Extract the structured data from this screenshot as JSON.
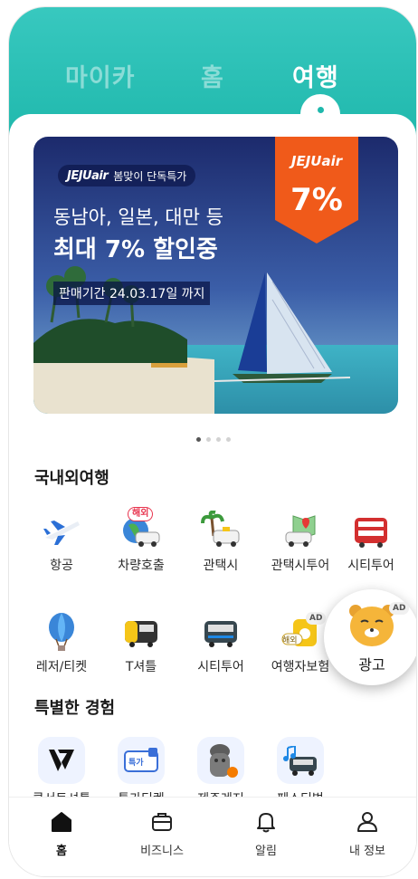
{
  "top_tabs": [
    {
      "label": "마이카",
      "active": false
    },
    {
      "label": "홈",
      "active": false
    },
    {
      "label": "여행",
      "active": true
    }
  ],
  "banner": {
    "brand": "JEJUair",
    "tag_text": "봄맞이 단독특가",
    "subtitle": "동남아, 일본, 대만 등",
    "headline": "최대 7% 할인중",
    "period": "판매기간 24.03.17일 까지",
    "badge_brand": "JEJUair",
    "badge_value": "7%",
    "page_count": 4,
    "current_page": 1
  },
  "domestic_section": {
    "title": "국내외여행",
    "items": [
      {
        "label": "항공",
        "icon": "airplane-icon"
      },
      {
        "label": "차량호출",
        "icon": "car-globe-icon",
        "tag": "해외"
      },
      {
        "label": "관택시",
        "icon": "taxi-palm-icon"
      },
      {
        "label": "관택시투어",
        "icon": "taxi-map-icon"
      },
      {
        "label": "시티투어",
        "icon": "double-decker-bus-icon"
      },
      {
        "label": "레저/티켓",
        "icon": "hot-air-balloon-icon"
      },
      {
        "label": "T셔틀",
        "icon": "shuttle-bus-icon"
      },
      {
        "label": "시티투어",
        "icon": "tour-bus-icon"
      },
      {
        "label": "여행자보험",
        "icon": "insurance-icon",
        "tag": "AD",
        "subtag": "해외"
      }
    ],
    "ad_item": {
      "label": "광고",
      "icon": "ryan-character-icon",
      "tag": "AD"
    }
  },
  "special_section": {
    "title": "특별한 경험",
    "items": [
      {
        "label": "콘서트셔틀",
        "icon": "v-logo-icon"
      },
      {
        "label": "특가티켓",
        "icon": "ticket-icon",
        "tag": "특가"
      },
      {
        "label": "제주레저",
        "icon": "dolharubang-icon"
      },
      {
        "label": "페스티벌",
        "icon": "music-bus-icon"
      }
    ]
  },
  "bottom_nav": [
    {
      "label": "홈",
      "icon": "home-icon",
      "active": true
    },
    {
      "label": "비즈니스",
      "icon": "briefcase-icon",
      "active": false
    },
    {
      "label": "알림",
      "icon": "bell-icon",
      "active": false
    },
    {
      "label": "내 정보",
      "icon": "person-icon",
      "active": false
    }
  ],
  "colors": {
    "header_teal": "#1fb8ac",
    "jeju_orange": "#f05a1a",
    "banner_navy": "#1a2a6e",
    "tag_red": "#e8344e"
  }
}
